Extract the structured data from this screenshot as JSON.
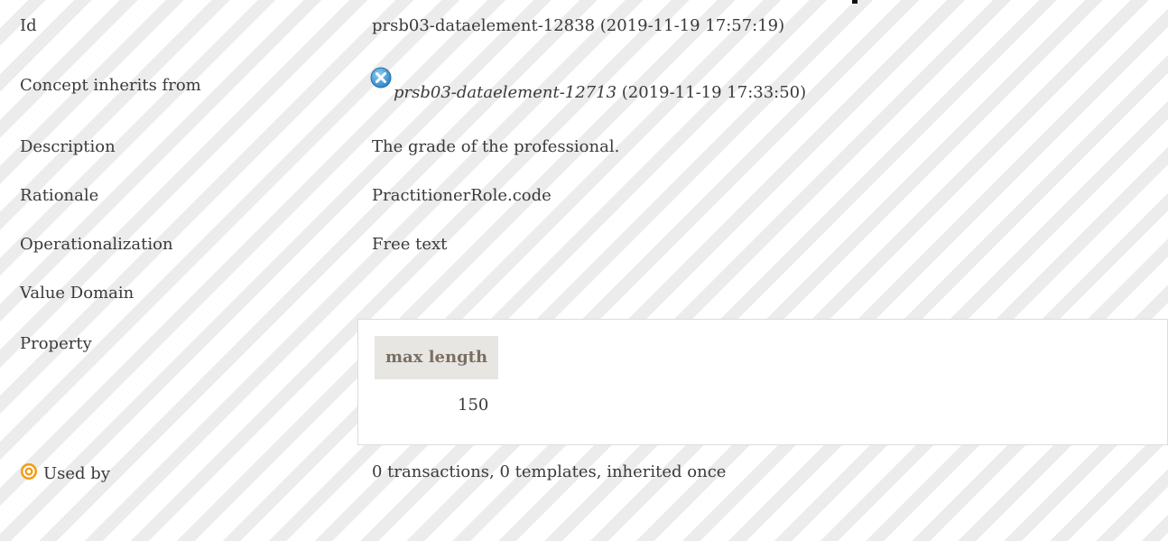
{
  "rows": {
    "id": {
      "label": "Id",
      "value": "prsb03-dataelement-12838 (2019-11-19 17:57:19)"
    },
    "inherits": {
      "label": "Concept inherits from",
      "link": "prsb03-dataelement-12713",
      "suffix": " (2019-11-19 17:33:50)"
    },
    "description": {
      "label": "Description",
      "value": "The grade of the professional."
    },
    "rationale": {
      "label": "Rationale",
      "value": "PractitionerRole.code"
    },
    "operationalization": {
      "label": "Operationalization",
      "value": "Free text"
    },
    "value_domain": {
      "label": "Value Domain"
    },
    "property": {
      "label": "Property",
      "header": "max length",
      "value": "150"
    },
    "used_by": {
      "label": "Used by",
      "value": "0 transactions, 0 templates, inherited once"
    }
  },
  "icons": {
    "inherit_icon": "close-circle-icon",
    "used_by_icon": "target-icon"
  },
  "colors": {
    "stripe_light": "#ffffff",
    "stripe_dark": "#ececec",
    "close_icon_blue": "#4aa3df",
    "target_orange": "#f39c12",
    "header_bg": "#e8e6e3",
    "header_text": "#7a6f63"
  }
}
